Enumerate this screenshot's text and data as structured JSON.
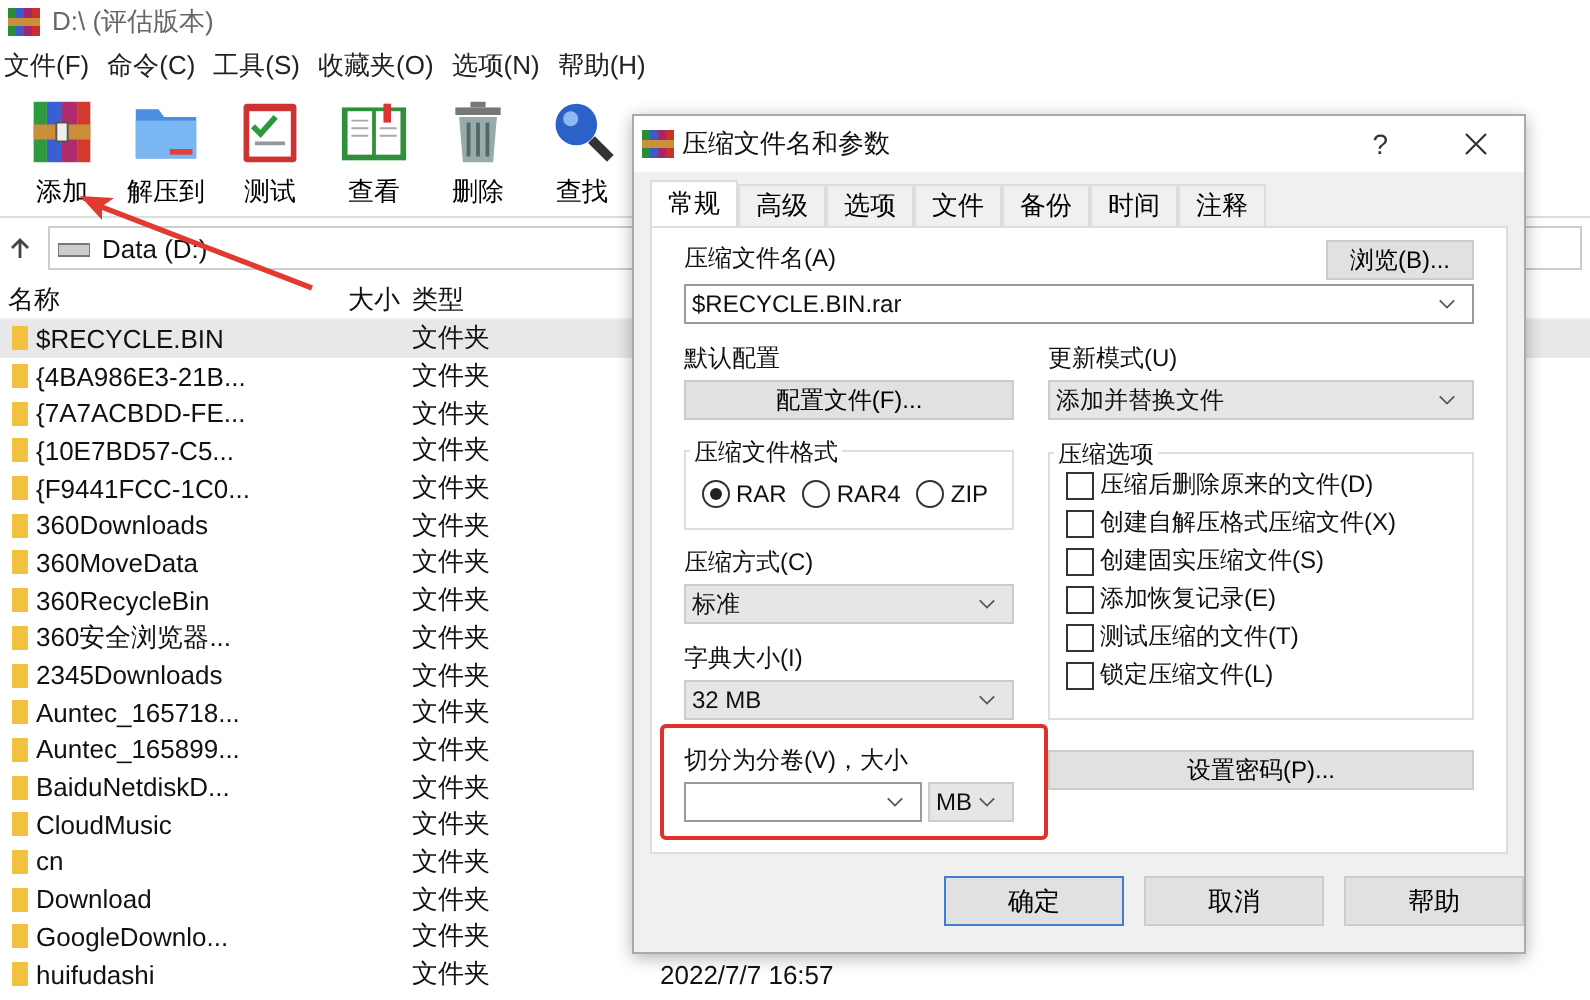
{
  "window": {
    "title": "D:\\ (评估版本)"
  },
  "menu": [
    "文件(F)",
    "命令(C)",
    "工具(S)",
    "收藏夹(O)",
    "选项(N)",
    "帮助(H)"
  ],
  "toolbar": [
    "添加",
    "解压到",
    "测试",
    "查看",
    "删除",
    "查找"
  ],
  "address": {
    "value": "Data (D:)"
  },
  "file_list": {
    "columns": [
      "名称",
      "大小",
      "类型"
    ],
    "rows": [
      {
        "name": "$RECYCLE.BIN",
        "type": "文件夹",
        "selected": true
      },
      {
        "name": "{4BA986E3-21B...",
        "type": "文件夹",
        "selected": false
      },
      {
        "name": "{7A7ACBDD-FE...",
        "type": "文件夹",
        "selected": false
      },
      {
        "name": "{10E7BD57-C5...",
        "type": "文件夹",
        "selected": false
      },
      {
        "name": "{F9441FCC-1C0...",
        "type": "文件夹",
        "selected": false
      },
      {
        "name": "360Downloads",
        "type": "文件夹",
        "selected": false
      },
      {
        "name": "360MoveData",
        "type": "文件夹",
        "selected": false
      },
      {
        "name": "360RecycleBin",
        "type": "文件夹",
        "selected": false
      },
      {
        "name": "360安全浏览器...",
        "type": "文件夹",
        "selected": false
      },
      {
        "name": "2345Downloads",
        "type": "文件夹",
        "selected": false
      },
      {
        "name": "Auntec_165718...",
        "type": "文件夹",
        "selected": false
      },
      {
        "name": "Auntec_165899...",
        "type": "文件夹",
        "selected": false
      },
      {
        "name": "BaiduNetdiskD...",
        "type": "文件夹",
        "selected": false
      },
      {
        "name": "CloudMusic",
        "type": "文件夹",
        "selected": false
      },
      {
        "name": "cn",
        "type": "文件夹",
        "selected": false
      },
      {
        "name": "Download",
        "type": "文件夹",
        "selected": false
      },
      {
        "name": "GoogleDownlo...",
        "type": "文件夹",
        "selected": false
      },
      {
        "name": "huifudashi",
        "type": "文件夹",
        "selected": false,
        "date": "2022/7/7 16:57"
      }
    ]
  },
  "dialog": {
    "title": "压缩文件名和参数",
    "help_glyph": "?",
    "tabs": [
      {
        "label": "常规",
        "selected": true
      },
      {
        "label": "高级",
        "selected": false
      },
      {
        "label": "选项",
        "selected": false
      },
      {
        "label": "文件",
        "selected": false
      },
      {
        "label": "备份",
        "selected": false
      },
      {
        "label": "时间",
        "selected": false
      },
      {
        "label": "注释",
        "selected": false
      }
    ],
    "archive_name": {
      "label": "压缩文件名(A)",
      "value": "$RECYCLE.BIN.rar",
      "browse": "浏览(B)..."
    },
    "profile": {
      "label": "默认配置",
      "button": "配置文件(F)..."
    },
    "update_mode": {
      "label": "更新模式(U)",
      "value": "添加并替换文件"
    },
    "format": {
      "title": "压缩文件格式",
      "options": [
        {
          "label": "RAR",
          "selected": true
        },
        {
          "label": "RAR4",
          "selected": false
        },
        {
          "label": "ZIP",
          "selected": false
        }
      ]
    },
    "method": {
      "label": "压缩方式(C)",
      "value": "标准"
    },
    "dictionary": {
      "label": "字典大小(I)",
      "value": "32 MB"
    },
    "split": {
      "label": "切分为分卷(V)，大小",
      "unit": "MB"
    },
    "options": {
      "title": "压缩选项",
      "items": [
        {
          "label": "压缩后删除原来的文件(D)",
          "checked": false
        },
        {
          "label": "创建自解压格式压缩文件(X)",
          "checked": false
        },
        {
          "label": "创建固实压缩文件(S)",
          "checked": false
        },
        {
          "label": "添加恢复记录(E)",
          "checked": false
        },
        {
          "label": "测试压缩的文件(T)",
          "checked": false
        },
        {
          "label": "锁定压缩文件(L)",
          "checked": false
        }
      ]
    },
    "password_button": "设置密码(P)...",
    "buttons": [
      "确定",
      "取消",
      "帮助"
    ]
  }
}
